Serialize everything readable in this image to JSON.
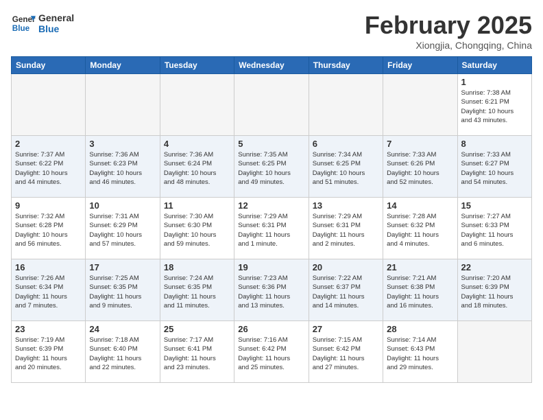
{
  "header": {
    "logo_general": "General",
    "logo_blue": "Blue",
    "month_title": "February 2025",
    "location": "Xiongjia, Chongqing, China"
  },
  "weekdays": [
    "Sunday",
    "Monday",
    "Tuesday",
    "Wednesday",
    "Thursday",
    "Friday",
    "Saturday"
  ],
  "weeks": [
    {
      "alt": false,
      "days": [
        {
          "num": "",
          "info": ""
        },
        {
          "num": "",
          "info": ""
        },
        {
          "num": "",
          "info": ""
        },
        {
          "num": "",
          "info": ""
        },
        {
          "num": "",
          "info": ""
        },
        {
          "num": "",
          "info": ""
        },
        {
          "num": "1",
          "info": "Sunrise: 7:38 AM\nSunset: 6:21 PM\nDaylight: 10 hours\nand 43 minutes."
        }
      ]
    },
    {
      "alt": true,
      "days": [
        {
          "num": "2",
          "info": "Sunrise: 7:37 AM\nSunset: 6:22 PM\nDaylight: 10 hours\nand 44 minutes."
        },
        {
          "num": "3",
          "info": "Sunrise: 7:36 AM\nSunset: 6:23 PM\nDaylight: 10 hours\nand 46 minutes."
        },
        {
          "num": "4",
          "info": "Sunrise: 7:36 AM\nSunset: 6:24 PM\nDaylight: 10 hours\nand 48 minutes."
        },
        {
          "num": "5",
          "info": "Sunrise: 7:35 AM\nSunset: 6:25 PM\nDaylight: 10 hours\nand 49 minutes."
        },
        {
          "num": "6",
          "info": "Sunrise: 7:34 AM\nSunset: 6:25 PM\nDaylight: 10 hours\nand 51 minutes."
        },
        {
          "num": "7",
          "info": "Sunrise: 7:33 AM\nSunset: 6:26 PM\nDaylight: 10 hours\nand 52 minutes."
        },
        {
          "num": "8",
          "info": "Sunrise: 7:33 AM\nSunset: 6:27 PM\nDaylight: 10 hours\nand 54 minutes."
        }
      ]
    },
    {
      "alt": false,
      "days": [
        {
          "num": "9",
          "info": "Sunrise: 7:32 AM\nSunset: 6:28 PM\nDaylight: 10 hours\nand 56 minutes."
        },
        {
          "num": "10",
          "info": "Sunrise: 7:31 AM\nSunset: 6:29 PM\nDaylight: 10 hours\nand 57 minutes."
        },
        {
          "num": "11",
          "info": "Sunrise: 7:30 AM\nSunset: 6:30 PM\nDaylight: 10 hours\nand 59 minutes."
        },
        {
          "num": "12",
          "info": "Sunrise: 7:29 AM\nSunset: 6:31 PM\nDaylight: 11 hours\nand 1 minute."
        },
        {
          "num": "13",
          "info": "Sunrise: 7:29 AM\nSunset: 6:31 PM\nDaylight: 11 hours\nand 2 minutes."
        },
        {
          "num": "14",
          "info": "Sunrise: 7:28 AM\nSunset: 6:32 PM\nDaylight: 11 hours\nand 4 minutes."
        },
        {
          "num": "15",
          "info": "Sunrise: 7:27 AM\nSunset: 6:33 PM\nDaylight: 11 hours\nand 6 minutes."
        }
      ]
    },
    {
      "alt": true,
      "days": [
        {
          "num": "16",
          "info": "Sunrise: 7:26 AM\nSunset: 6:34 PM\nDaylight: 11 hours\nand 7 minutes."
        },
        {
          "num": "17",
          "info": "Sunrise: 7:25 AM\nSunset: 6:35 PM\nDaylight: 11 hours\nand 9 minutes."
        },
        {
          "num": "18",
          "info": "Sunrise: 7:24 AM\nSunset: 6:35 PM\nDaylight: 11 hours\nand 11 minutes."
        },
        {
          "num": "19",
          "info": "Sunrise: 7:23 AM\nSunset: 6:36 PM\nDaylight: 11 hours\nand 13 minutes."
        },
        {
          "num": "20",
          "info": "Sunrise: 7:22 AM\nSunset: 6:37 PM\nDaylight: 11 hours\nand 14 minutes."
        },
        {
          "num": "21",
          "info": "Sunrise: 7:21 AM\nSunset: 6:38 PM\nDaylight: 11 hours\nand 16 minutes."
        },
        {
          "num": "22",
          "info": "Sunrise: 7:20 AM\nSunset: 6:39 PM\nDaylight: 11 hours\nand 18 minutes."
        }
      ]
    },
    {
      "alt": false,
      "days": [
        {
          "num": "23",
          "info": "Sunrise: 7:19 AM\nSunset: 6:39 PM\nDaylight: 11 hours\nand 20 minutes."
        },
        {
          "num": "24",
          "info": "Sunrise: 7:18 AM\nSunset: 6:40 PM\nDaylight: 11 hours\nand 22 minutes."
        },
        {
          "num": "25",
          "info": "Sunrise: 7:17 AM\nSunset: 6:41 PM\nDaylight: 11 hours\nand 23 minutes."
        },
        {
          "num": "26",
          "info": "Sunrise: 7:16 AM\nSunset: 6:42 PM\nDaylight: 11 hours\nand 25 minutes."
        },
        {
          "num": "27",
          "info": "Sunrise: 7:15 AM\nSunset: 6:42 PM\nDaylight: 11 hours\nand 27 minutes."
        },
        {
          "num": "28",
          "info": "Sunrise: 7:14 AM\nSunset: 6:43 PM\nDaylight: 11 hours\nand 29 minutes."
        },
        {
          "num": "",
          "info": ""
        }
      ]
    }
  ]
}
